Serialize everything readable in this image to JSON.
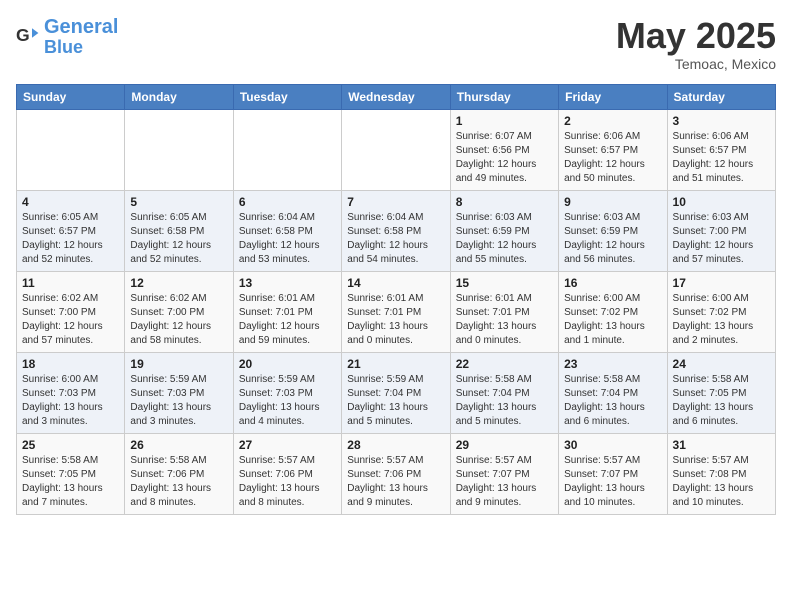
{
  "header": {
    "logo_general": "General",
    "logo_blue": "Blue",
    "month": "May 2025",
    "location": "Temoac, Mexico"
  },
  "weekdays": [
    "Sunday",
    "Monday",
    "Tuesday",
    "Wednesday",
    "Thursday",
    "Friday",
    "Saturday"
  ],
  "weeks": [
    [
      {
        "day": "",
        "info": ""
      },
      {
        "day": "",
        "info": ""
      },
      {
        "day": "",
        "info": ""
      },
      {
        "day": "",
        "info": ""
      },
      {
        "day": "1",
        "info": "Sunrise: 6:07 AM\nSunset: 6:56 PM\nDaylight: 12 hours\nand 49 minutes."
      },
      {
        "day": "2",
        "info": "Sunrise: 6:06 AM\nSunset: 6:57 PM\nDaylight: 12 hours\nand 50 minutes."
      },
      {
        "day": "3",
        "info": "Sunrise: 6:06 AM\nSunset: 6:57 PM\nDaylight: 12 hours\nand 51 minutes."
      }
    ],
    [
      {
        "day": "4",
        "info": "Sunrise: 6:05 AM\nSunset: 6:57 PM\nDaylight: 12 hours\nand 52 minutes."
      },
      {
        "day": "5",
        "info": "Sunrise: 6:05 AM\nSunset: 6:58 PM\nDaylight: 12 hours\nand 52 minutes."
      },
      {
        "day": "6",
        "info": "Sunrise: 6:04 AM\nSunset: 6:58 PM\nDaylight: 12 hours\nand 53 minutes."
      },
      {
        "day": "7",
        "info": "Sunrise: 6:04 AM\nSunset: 6:58 PM\nDaylight: 12 hours\nand 54 minutes."
      },
      {
        "day": "8",
        "info": "Sunrise: 6:03 AM\nSunset: 6:59 PM\nDaylight: 12 hours\nand 55 minutes."
      },
      {
        "day": "9",
        "info": "Sunrise: 6:03 AM\nSunset: 6:59 PM\nDaylight: 12 hours\nand 56 minutes."
      },
      {
        "day": "10",
        "info": "Sunrise: 6:03 AM\nSunset: 7:00 PM\nDaylight: 12 hours\nand 57 minutes."
      }
    ],
    [
      {
        "day": "11",
        "info": "Sunrise: 6:02 AM\nSunset: 7:00 PM\nDaylight: 12 hours\nand 57 minutes."
      },
      {
        "day": "12",
        "info": "Sunrise: 6:02 AM\nSunset: 7:00 PM\nDaylight: 12 hours\nand 58 minutes."
      },
      {
        "day": "13",
        "info": "Sunrise: 6:01 AM\nSunset: 7:01 PM\nDaylight: 12 hours\nand 59 minutes."
      },
      {
        "day": "14",
        "info": "Sunrise: 6:01 AM\nSunset: 7:01 PM\nDaylight: 13 hours\nand 0 minutes."
      },
      {
        "day": "15",
        "info": "Sunrise: 6:01 AM\nSunset: 7:01 PM\nDaylight: 13 hours\nand 0 minutes."
      },
      {
        "day": "16",
        "info": "Sunrise: 6:00 AM\nSunset: 7:02 PM\nDaylight: 13 hours\nand 1 minute."
      },
      {
        "day": "17",
        "info": "Sunrise: 6:00 AM\nSunset: 7:02 PM\nDaylight: 13 hours\nand 2 minutes."
      }
    ],
    [
      {
        "day": "18",
        "info": "Sunrise: 6:00 AM\nSunset: 7:03 PM\nDaylight: 13 hours\nand 3 minutes."
      },
      {
        "day": "19",
        "info": "Sunrise: 5:59 AM\nSunset: 7:03 PM\nDaylight: 13 hours\nand 3 minutes."
      },
      {
        "day": "20",
        "info": "Sunrise: 5:59 AM\nSunset: 7:03 PM\nDaylight: 13 hours\nand 4 minutes."
      },
      {
        "day": "21",
        "info": "Sunrise: 5:59 AM\nSunset: 7:04 PM\nDaylight: 13 hours\nand 5 minutes."
      },
      {
        "day": "22",
        "info": "Sunrise: 5:58 AM\nSunset: 7:04 PM\nDaylight: 13 hours\nand 5 minutes."
      },
      {
        "day": "23",
        "info": "Sunrise: 5:58 AM\nSunset: 7:04 PM\nDaylight: 13 hours\nand 6 minutes."
      },
      {
        "day": "24",
        "info": "Sunrise: 5:58 AM\nSunset: 7:05 PM\nDaylight: 13 hours\nand 6 minutes."
      }
    ],
    [
      {
        "day": "25",
        "info": "Sunrise: 5:58 AM\nSunset: 7:05 PM\nDaylight: 13 hours\nand 7 minutes."
      },
      {
        "day": "26",
        "info": "Sunrise: 5:58 AM\nSunset: 7:06 PM\nDaylight: 13 hours\nand 8 minutes."
      },
      {
        "day": "27",
        "info": "Sunrise: 5:57 AM\nSunset: 7:06 PM\nDaylight: 13 hours\nand 8 minutes."
      },
      {
        "day": "28",
        "info": "Sunrise: 5:57 AM\nSunset: 7:06 PM\nDaylight: 13 hours\nand 9 minutes."
      },
      {
        "day": "29",
        "info": "Sunrise: 5:57 AM\nSunset: 7:07 PM\nDaylight: 13 hours\nand 9 minutes."
      },
      {
        "day": "30",
        "info": "Sunrise: 5:57 AM\nSunset: 7:07 PM\nDaylight: 13 hours\nand 10 minutes."
      },
      {
        "day": "31",
        "info": "Sunrise: 5:57 AM\nSunset: 7:08 PM\nDaylight: 13 hours\nand 10 minutes."
      }
    ]
  ]
}
